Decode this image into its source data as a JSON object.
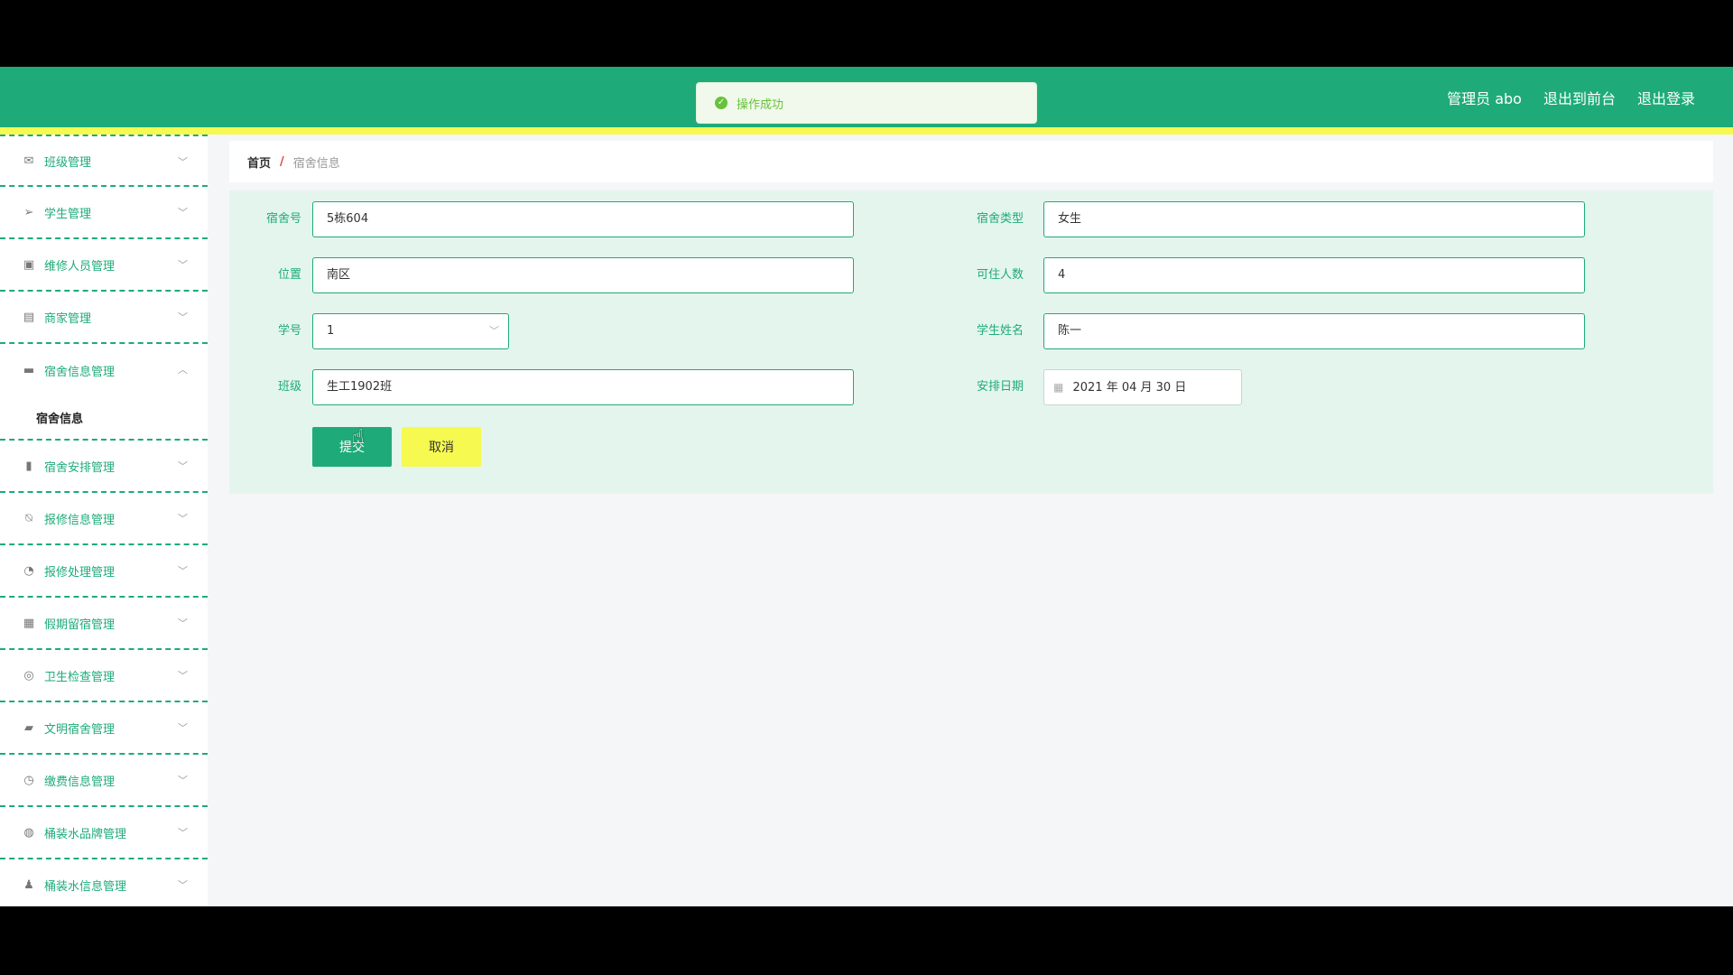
{
  "toast": {
    "message": "操作成功",
    "icon": "check-circle-icon"
  },
  "header": {
    "admin_label": "管理员 abo",
    "to_front": "退出到前台",
    "logout": "退出登录",
    "color": "#1eab79",
    "accent": "#f6f94f"
  },
  "sidebar": {
    "items": [
      {
        "label": "班级管理",
        "icon": "mail-icon"
      },
      {
        "label": "学生管理",
        "icon": "send-icon"
      },
      {
        "label": "维修人员管理",
        "icon": "delete-bin-icon"
      },
      {
        "label": "商家管理",
        "icon": "id-card-icon"
      },
      {
        "label": "宿舍信息管理",
        "icon": "briefcase-icon",
        "open": true,
        "sub": [
          "宿舍信息"
        ]
      },
      {
        "label": "宿舍安排管理",
        "icon": "clipboard-icon"
      },
      {
        "label": "报修信息管理",
        "icon": "bell-off-icon"
      },
      {
        "label": "报修处理管理",
        "icon": "odometer-icon"
      },
      {
        "label": "假期留宿管理",
        "icon": "grid-icon"
      },
      {
        "label": "卫生检查管理",
        "icon": "help-icon"
      },
      {
        "label": "文明宿舍管理",
        "icon": "chat-icon"
      },
      {
        "label": "缴费信息管理",
        "icon": "clock-icon"
      },
      {
        "label": "桶装水品牌管理",
        "icon": "compass-icon"
      },
      {
        "label": "桶装水信息管理",
        "icon": "user-icon"
      }
    ]
  },
  "breadcrumb": {
    "home": "首页",
    "separator": "/",
    "current": "宿舍信息"
  },
  "form": {
    "dorm_no": {
      "label": "宿舍号",
      "value": "5栋604"
    },
    "dorm_type": {
      "label": "宿舍类型",
      "value": "女生"
    },
    "location": {
      "label": "位置",
      "value": "南区"
    },
    "capacity": {
      "label": "可住人数",
      "value": "4"
    },
    "student_id": {
      "label": "学号",
      "value": "1"
    },
    "student_name": {
      "label": "学生姓名",
      "value": "陈一"
    },
    "class_name": {
      "label": "班级",
      "value": "生工1902班"
    },
    "arrange_date": {
      "label": "安排日期",
      "value": "2021 年 04 月 30 日"
    },
    "submit_label": "提交",
    "cancel_label": "取消"
  }
}
